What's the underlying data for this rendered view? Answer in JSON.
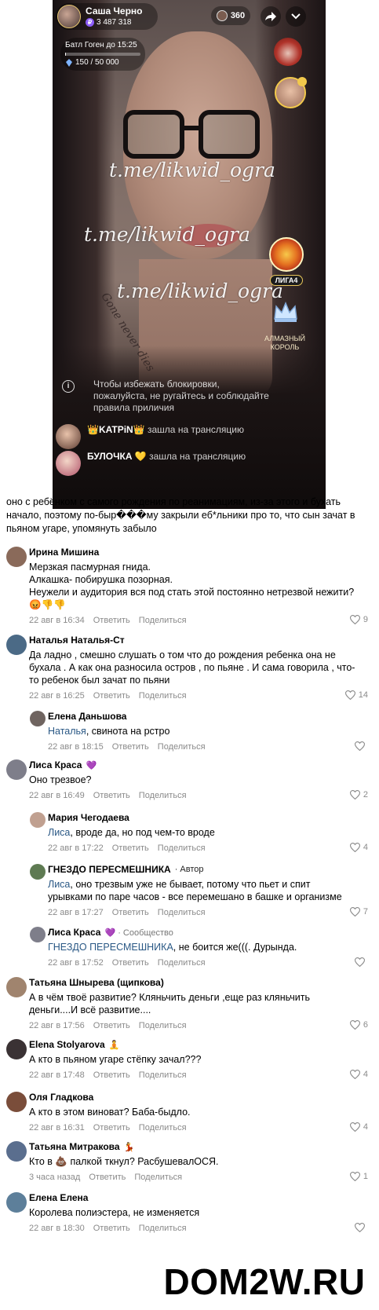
{
  "stream": {
    "host_name": "Саша Черно",
    "host_coins": "3 487 318",
    "battle_label": "Батл Гоген до 15:25",
    "battle_score": "150 / 50 000",
    "battle_progress": 0.003,
    "viewers": "360",
    "league_label": "ЛИГА4",
    "diamond_king_label": "АЛМАЗНЫЙ КОРОЛЬ",
    "watermark_text": "t.me/likwid_ogra",
    "tattoo_text": "Gone never dies",
    "warning": "Чтобы избежать блокировки, пожалуйста, не ругайтесь и соблюдайте правила приличия",
    "joins": [
      {
        "nick": "👑KATPiN👑",
        "text": " зашла на трансляцию"
      },
      {
        "nick": "БУЛОЧКА 💛",
        "text": " зашла на трансляцию"
      }
    ]
  },
  "post": {
    "text": "оно с ребёнком с самого рождения по реанимациям, из-за этого и бухать начало, поэтому по-быр���му закрыли еб*льники про то, что сын зачат в пьяном угаре, упомянуть забыло"
  },
  "actions": {
    "reply": "Ответить",
    "share": "Поделиться"
  },
  "comments": [
    {
      "name": "Ирина Мишина",
      "badge": "",
      "text": "Мерзкая пасмурная гнида.\nАлкашка- побирушка позорная.\nНеужели и аудитория вся под стать этой постоянно нетрезвой нежити? 😡👎👎",
      "time": "22 авг в 16:34",
      "likes": "9"
    },
    {
      "name": "Наталья Наталья-Ст",
      "badge": "",
      "text": "Да ладно , смешно слушать о том что до рождения ребенка она не бухала . А как она разносила остров , по пьяне . И сама говорила , что-то ребенок был зачат по пьяни",
      "time": "22 авг в 16:25",
      "likes": "14"
    },
    {
      "name": "Елена Даньшова",
      "badge": "",
      "to": "Наталья",
      "text": ", свинота на рстро",
      "time": "22 авг в 18:15",
      "likes": ""
    },
    {
      "name": "Лиса Краса",
      "badge": "💜",
      "text": "Оно трезвое?",
      "time": "22 авг в 16:49",
      "likes": "2"
    },
    {
      "name": "Мария Чегодаева",
      "badge": "",
      "to": "Лиса",
      "text": ", вроде да, но под чем-то вроде",
      "time": "22 авг в 17:22",
      "likes": "4"
    },
    {
      "name": "ГНЕЗДО ПЕРЕСМЕШНИКА",
      "badge": "· Автор",
      "to": "Лиса",
      "text": ", оно трезвым уже не бывает, потому что пьет и спит урывками по паре часов - все перемешано в башке и организме",
      "time": "22 авг в 17:27",
      "likes": "7"
    },
    {
      "name": "Лиса Краса",
      "badge": "💜 · Сообщество",
      "to": "ГНЕЗДО ПЕРЕСМЕШНИКА",
      "text": ", не боится же(((. Дурында.",
      "time": "22 авг в 17:52",
      "likes": ""
    },
    {
      "name": "Татьяна Шнырева (щипкова)",
      "badge": "",
      "text": "А в чём твоё развитие? Кляньчить деньги ,еще раз кляньчить деньги....И всё развитие....",
      "time": "22 авг в 17:56",
      "likes": "6"
    },
    {
      "name": "Elena Stolyarova",
      "badge": "🧘",
      "text": "А кто в пьяном угаре стёпку зачал???",
      "time": "22 авг в 17:48",
      "likes": "4"
    },
    {
      "name": "Оля Гладкова",
      "badge": "",
      "text": "А кто в этом виноват? Баба-быдло.",
      "time": "22 авг в 16:31",
      "likes": "4"
    },
    {
      "name": "Татьяна Митракова",
      "badge": "💃",
      "text": "Кто в 💩 палкой ткнул? РасбушевалОСЯ.",
      "time": "3 часа назад",
      "likes": "1"
    },
    {
      "name": "Елена Елена",
      "badge": "",
      "text": "Королева полиэстера, не изменяется",
      "time": "22 авг в 18:30",
      "likes": ""
    }
  ],
  "site_watermark": "DOM2W.RU",
  "colors": {
    "link": "#2a5885",
    "meta": "#8a8a8a",
    "coin": "#8b5cf6"
  }
}
